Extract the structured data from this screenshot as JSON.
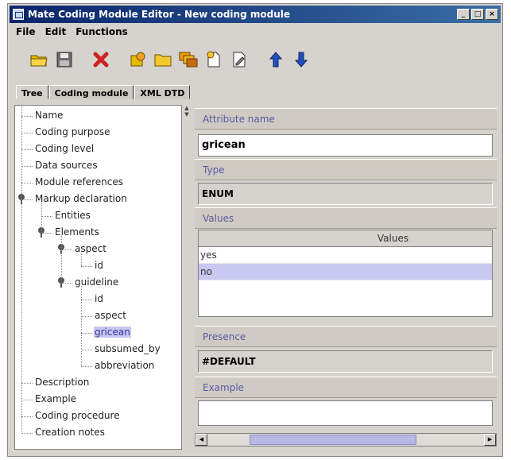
{
  "window": {
    "title": "Mate Coding Module Editor - New coding module",
    "controls": [
      "_",
      "□",
      "×"
    ]
  },
  "menu": [
    "File",
    "Edit",
    "Functions"
  ],
  "toolbar": {
    "icons": [
      "open-folder-icon",
      "save-icon",
      "delete-icon",
      "add-item-icon",
      "folder-icon",
      "copy-icon",
      "new-document-icon",
      "edit-document-icon",
      "move-up-icon",
      "move-down-icon"
    ],
    "colors": {
      "delete": "#cc2222",
      "folder": "#e8b800",
      "arrow": "#2050c0"
    }
  },
  "tabs": [
    "Tree",
    "Coding module",
    "XML DTD"
  ],
  "tree": {
    "nodes": [
      {
        "label": "Name",
        "depth": 0
      },
      {
        "label": "Coding purpose",
        "depth": 0
      },
      {
        "label": "Coding level",
        "depth": 0
      },
      {
        "label": "Data sources",
        "depth": 0
      },
      {
        "label": "Module references",
        "depth": 0
      },
      {
        "label": "Markup declaration",
        "depth": 0,
        "expandable": true
      },
      {
        "label": "Entities",
        "depth": 1
      },
      {
        "label": "Elements",
        "depth": 1,
        "expandable": true
      },
      {
        "label": "aspect",
        "depth": 2,
        "expandable": true
      },
      {
        "label": "id",
        "depth": 3
      },
      {
        "label": "guideline",
        "depth": 2,
        "expandable": true
      },
      {
        "label": "id",
        "depth": 3
      },
      {
        "label": "aspect",
        "depth": 3
      },
      {
        "label": "gricean",
        "depth": 3,
        "selected": true
      },
      {
        "label": "subsumed_by",
        "depth": 3
      },
      {
        "label": "abbreviation",
        "depth": 3
      },
      {
        "label": "Description",
        "depth": 0
      },
      {
        "label": "Example",
        "depth": 0
      },
      {
        "label": "Coding procedure",
        "depth": 0
      },
      {
        "label": "Creation notes",
        "depth": 0
      }
    ]
  },
  "attribute": {
    "name_label": "Attribute name",
    "name_value": "gricean",
    "type_label": "Type",
    "type_value": "ENUM",
    "values_label": "Values",
    "values_header": "Values",
    "values": [
      {
        "text": "yes",
        "selected": false
      },
      {
        "text": "no",
        "selected": true
      }
    ],
    "presence_label": "Presence",
    "presence_value": "#DEFAULT",
    "example_label": "Example",
    "example_value": ""
  },
  "scrollbar": {
    "position_fraction": 0.15,
    "visible_fraction": 0.6
  }
}
